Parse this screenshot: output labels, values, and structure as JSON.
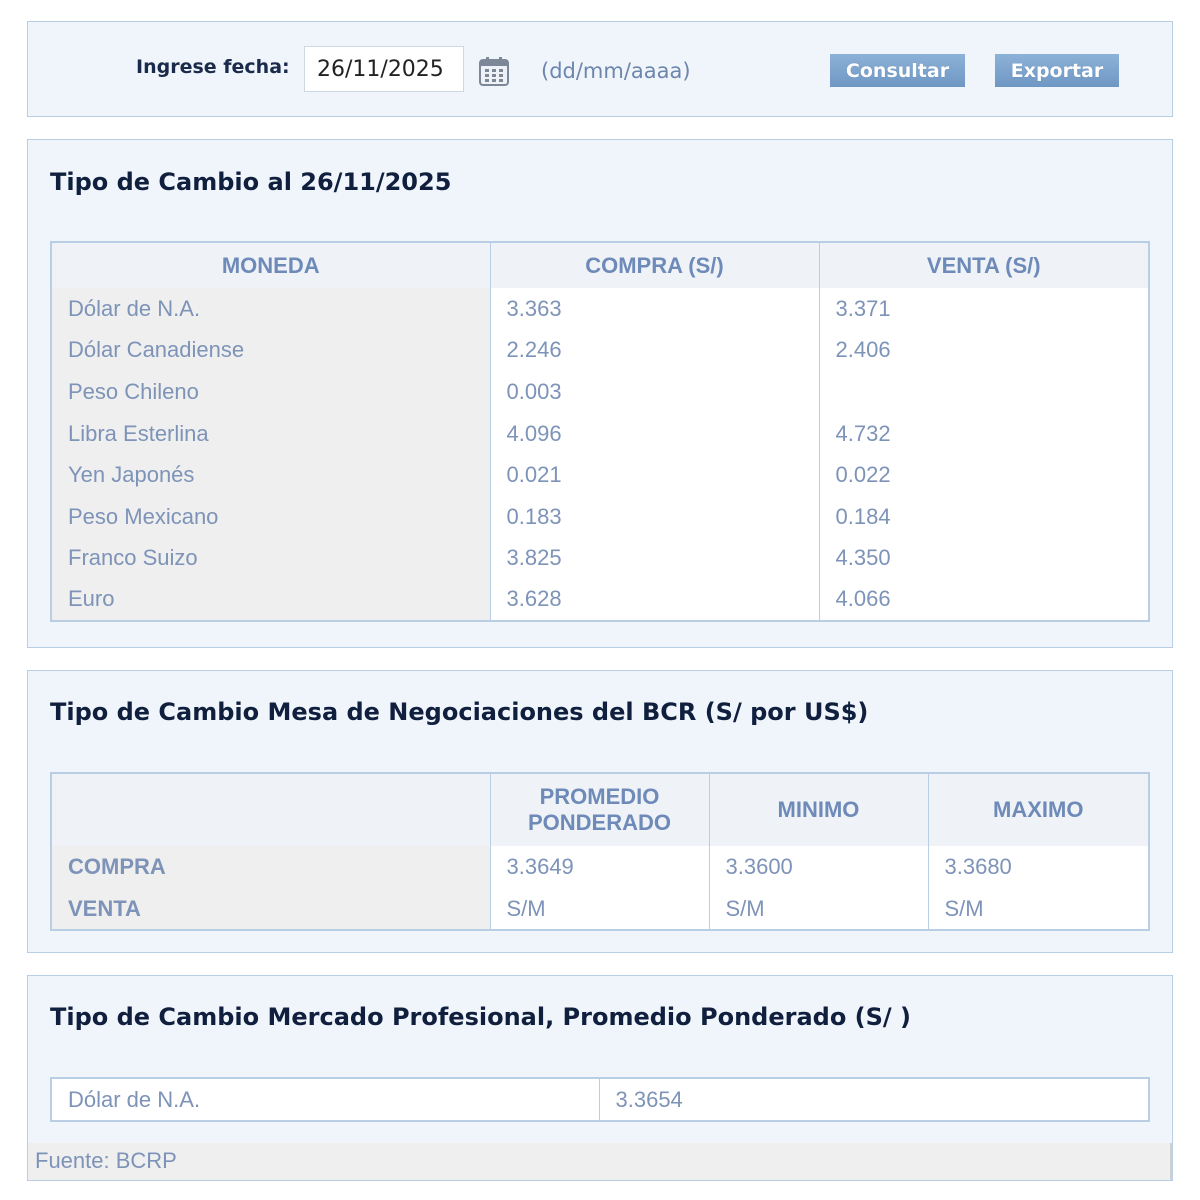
{
  "search": {
    "label": "Ingrese fecha:",
    "date_value": "26/11/2025",
    "date_format_hint": "(dd/mm/aaaa)",
    "consultar_label": "Consultar",
    "exportar_label": "Exportar"
  },
  "tipo_cambio": {
    "title": "Tipo de Cambio al 26/11/2025",
    "headers": [
      "MONEDA",
      "COMPRA (S/)",
      "VENTA (S/)"
    ],
    "rows": [
      [
        "Dólar de N.A.",
        "3.363",
        "3.371"
      ],
      [
        "Dólar Canadiense",
        "2.246",
        "2.406"
      ],
      [
        "Peso Chileno",
        "0.003",
        ""
      ],
      [
        "Libra Esterlina",
        "4.096",
        "4.732"
      ],
      [
        "Yen Japonés",
        "0.021",
        "0.022"
      ],
      [
        "Peso Mexicano",
        "0.183",
        "0.184"
      ],
      [
        "Franco Suizo",
        "3.825",
        "4.350"
      ],
      [
        "Euro",
        "3.628",
        "4.066"
      ]
    ]
  },
  "mesa_bcr": {
    "title": "Tipo de Cambio Mesa de Negociaciones del BCR (S/ por US$)",
    "headers": [
      "",
      "PROMEDIO PONDERADO",
      "MINIMO",
      "MAXIMO"
    ],
    "rows": [
      [
        "COMPRA",
        "3.3649",
        "3.3600",
        "3.3680"
      ],
      [
        "VENTA",
        "S/M",
        "S/M",
        "S/M"
      ]
    ]
  },
  "mercado_profesional": {
    "title": "Tipo de Cambio Mercado Profesional, Promedio Ponderado (S/ )",
    "rows": [
      [
        "Dólar de N.A.",
        "3.3654"
      ]
    ]
  },
  "footer": {
    "source": "Fuente: BCRP"
  },
  "colors": {
    "panel_background": "#f0f5fb",
    "panel_border": "#b9cde4",
    "header_text": "#6e8ab8",
    "cell_text": "#7d93b8",
    "title_text": "#0f1f3d",
    "button_background": "#7aa2cc"
  },
  "icons": {
    "calendar": "calendar-icon"
  }
}
